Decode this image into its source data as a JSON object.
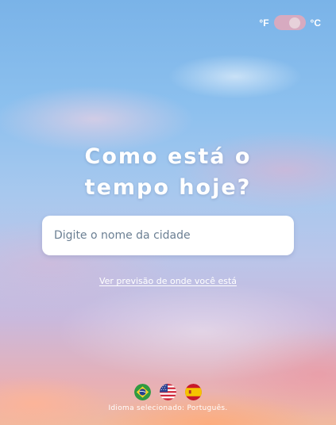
{
  "units": {
    "fahrenheit_label": "°F",
    "celsius_label": "°C",
    "selected": "celsius"
  },
  "headline": {
    "line1": "Como está o",
    "line2": "tempo hoje?"
  },
  "search": {
    "placeholder": "Digite o nome da cidade",
    "value": ""
  },
  "location_link": "Ver previsão de onde você está",
  "languages": {
    "flags": [
      {
        "icon": "brazil-flag-icon",
        "language": "Português"
      },
      {
        "icon": "usa-flag-icon",
        "language": "English"
      },
      {
        "icon": "spain-flag-icon",
        "language": "Español"
      }
    ],
    "status": "Idioma selecionado: Português."
  },
  "colors": {
    "toggle_track": "#dcaabe",
    "text": "#ffffff"
  }
}
